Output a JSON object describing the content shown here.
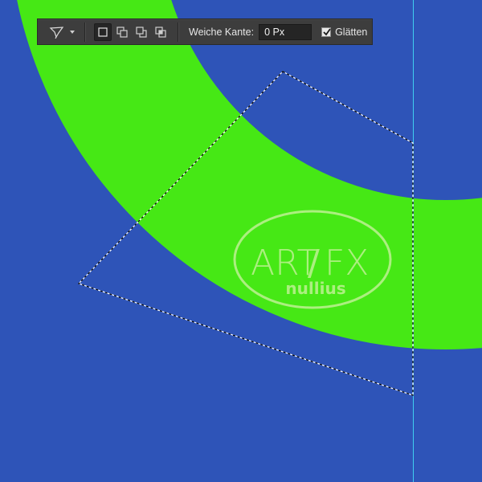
{
  "colors": {
    "canvas_background": "#2e54b8",
    "ring_fill": "#46e815",
    "guide_line": "#3fd0f0",
    "watermark": "#b8f08c",
    "options_bar_bg": "#3d3d3d"
  },
  "options_bar": {
    "tool_icon": "polygonal-lasso-icon",
    "selection_modes": [
      {
        "name": "new-selection",
        "icon": "new-selection-icon",
        "active": true
      },
      {
        "name": "add-to-selection",
        "icon": "add-to-selection-icon",
        "active": false
      },
      {
        "name": "subtract-from-selection",
        "icon": "subtract-from-selection-icon",
        "active": false
      },
      {
        "name": "intersect-with-selection",
        "icon": "intersect-selection-icon",
        "active": false
      }
    ],
    "feather_label": "Weiche Kante:",
    "feather_value": "0 Px",
    "antialias_label": "Glätten",
    "antialias_checked": true
  },
  "watermark": {
    "line1_part_a": "ART",
    "line1_part_b": "/",
    "line1_part_c": "FX",
    "line2": "nullius"
  }
}
